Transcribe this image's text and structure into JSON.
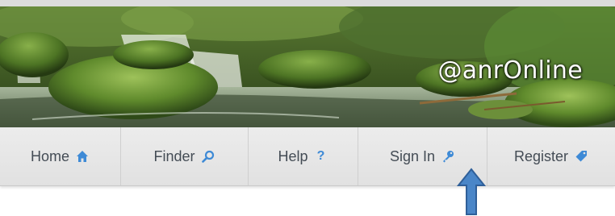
{
  "banner": {
    "brand_text": "@anrOnline"
  },
  "nav": {
    "items": [
      {
        "label": "Home",
        "icon": "home-icon"
      },
      {
        "label": "Finder",
        "icon": "search-icon"
      },
      {
        "label": "Help",
        "icon": "question-icon",
        "icon_glyph": "?"
      },
      {
        "label": "Sign In",
        "icon": "key-icon"
      },
      {
        "label": "Register",
        "icon": "tag-icon"
      }
    ]
  },
  "colors": {
    "nav_background": "#e4e4e4",
    "nav_text": "#444c55",
    "icon_accent": "#3e8ad6",
    "annotation_arrow": "#4a86c8"
  },
  "annotation": {
    "type": "arrow-up",
    "points_to": "Sign In"
  }
}
